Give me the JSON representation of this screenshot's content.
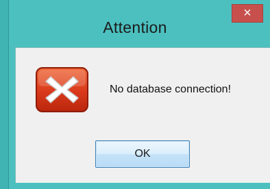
{
  "window": {
    "title": "Attention",
    "close_glyph": "×",
    "accent_color": "#4bc0bf",
    "close_color": "#c7504c"
  },
  "message": {
    "icon": "error-x-icon",
    "text": "No database connection!"
  },
  "buttons": {
    "ok_label": "OK"
  }
}
